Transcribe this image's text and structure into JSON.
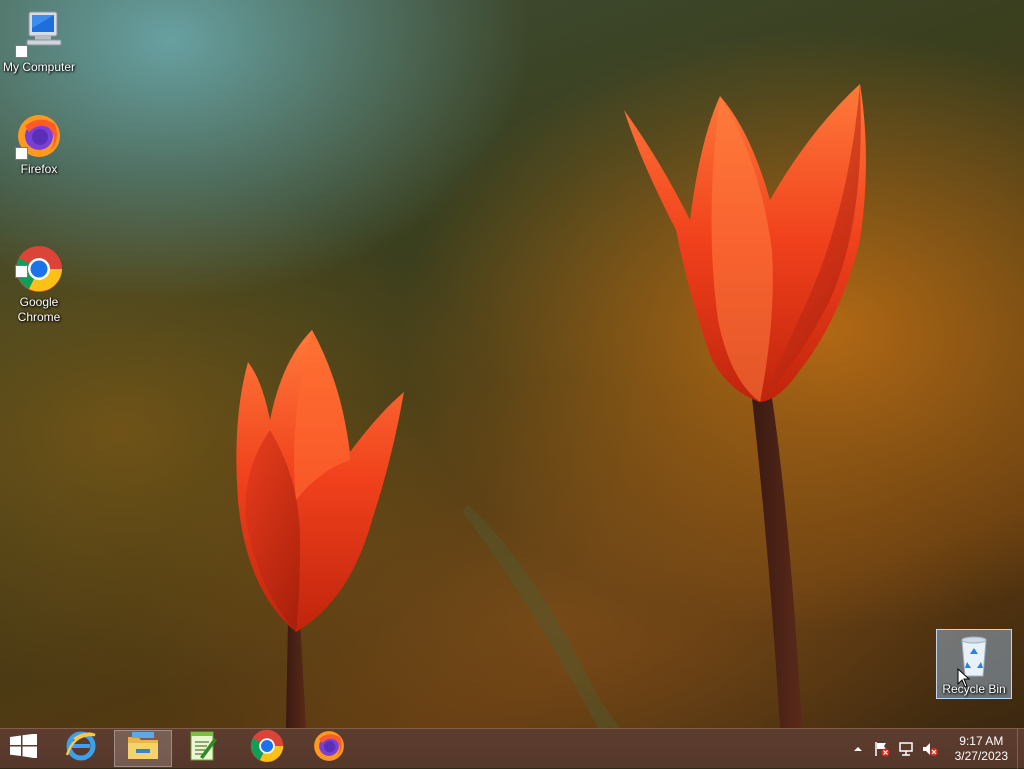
{
  "desktop": {
    "icons": [
      {
        "label": "My Computer",
        "icon": "my-computer-icon"
      },
      {
        "label": "Firefox",
        "icon": "firefox-icon"
      },
      {
        "label": "Google\nChrome",
        "icon": "chrome-icon"
      },
      {
        "label": "Recycle Bin",
        "icon": "recycle-bin-icon",
        "selected": true
      }
    ],
    "wallpaper": "orange tulips"
  },
  "taskbar": {
    "start_icon": "windows-logo-icon",
    "pinned": [
      {
        "name": "Internet Explorer",
        "icon": "internet-explorer-icon"
      },
      {
        "name": "File Explorer",
        "icon": "file-explorer-icon",
        "active": true
      },
      {
        "name": "Notepad++",
        "icon": "notepad-plus-plus-icon"
      },
      {
        "name": "Google Chrome",
        "icon": "chrome-icon"
      },
      {
        "name": "Firefox",
        "icon": "firefox-icon"
      }
    ],
    "tray": {
      "icons": [
        "show-hidden-icons-icon",
        "action-center-flag-icon",
        "network-icon",
        "volume-muted-icon"
      ],
      "time": "9:17 AM",
      "date": "3/27/2023"
    }
  },
  "colors": {
    "taskbar": "#5a3a2e",
    "selection": "#a0c8f0"
  }
}
